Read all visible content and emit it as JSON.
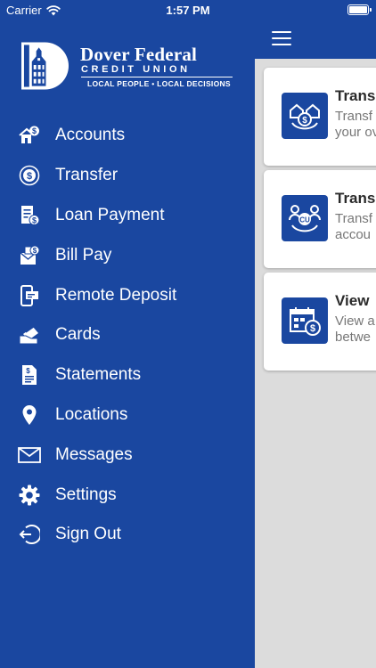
{
  "status_bar": {
    "carrier": "Carrier",
    "time": "1:57 PM"
  },
  "brand": {
    "name": "Dover Federal",
    "subtitle": "CREDIT UNION",
    "tagline": "LOCAL PEOPLE • LOCAL DECISIONS"
  },
  "colors": {
    "primary": "#1a47a0",
    "content_bg": "#dcdcdc",
    "card_bg": "#ffffff",
    "title_text": "#2b2b2b",
    "desc_text": "#777777"
  },
  "menu": {
    "items": [
      {
        "label": "Accounts",
        "icon": "house-dollar-icon"
      },
      {
        "label": "Transfer",
        "icon": "dollar-circle-icon"
      },
      {
        "label": "Loan Payment",
        "icon": "loan-document-icon"
      },
      {
        "label": "Bill Pay",
        "icon": "envelope-dollar-icon"
      },
      {
        "label": "Remote Deposit",
        "icon": "phone-check-icon"
      },
      {
        "label": "Cards",
        "icon": "card-hand-icon"
      },
      {
        "label": "Statements",
        "icon": "statement-icon"
      },
      {
        "label": "Locations",
        "icon": "map-pin-icon"
      },
      {
        "label": "Messages",
        "icon": "mail-icon"
      },
      {
        "label": "Settings",
        "icon": "gear-icon"
      },
      {
        "label": "Sign Out",
        "icon": "sign-out-icon"
      }
    ]
  },
  "main": {
    "cards": [
      {
        "title": "Trans",
        "desc_line1": "Transf",
        "desc_line2": "your ov",
        "icon": "transfer-houses-icon"
      },
      {
        "title": "Trans",
        "desc_line1": "Transf",
        "desc_line2": "accou",
        "icon": "transfer-members-icon"
      },
      {
        "title": "View",
        "desc_line1": "View a",
        "desc_line2": "betwe",
        "icon": "calendar-dollar-icon"
      }
    ]
  }
}
